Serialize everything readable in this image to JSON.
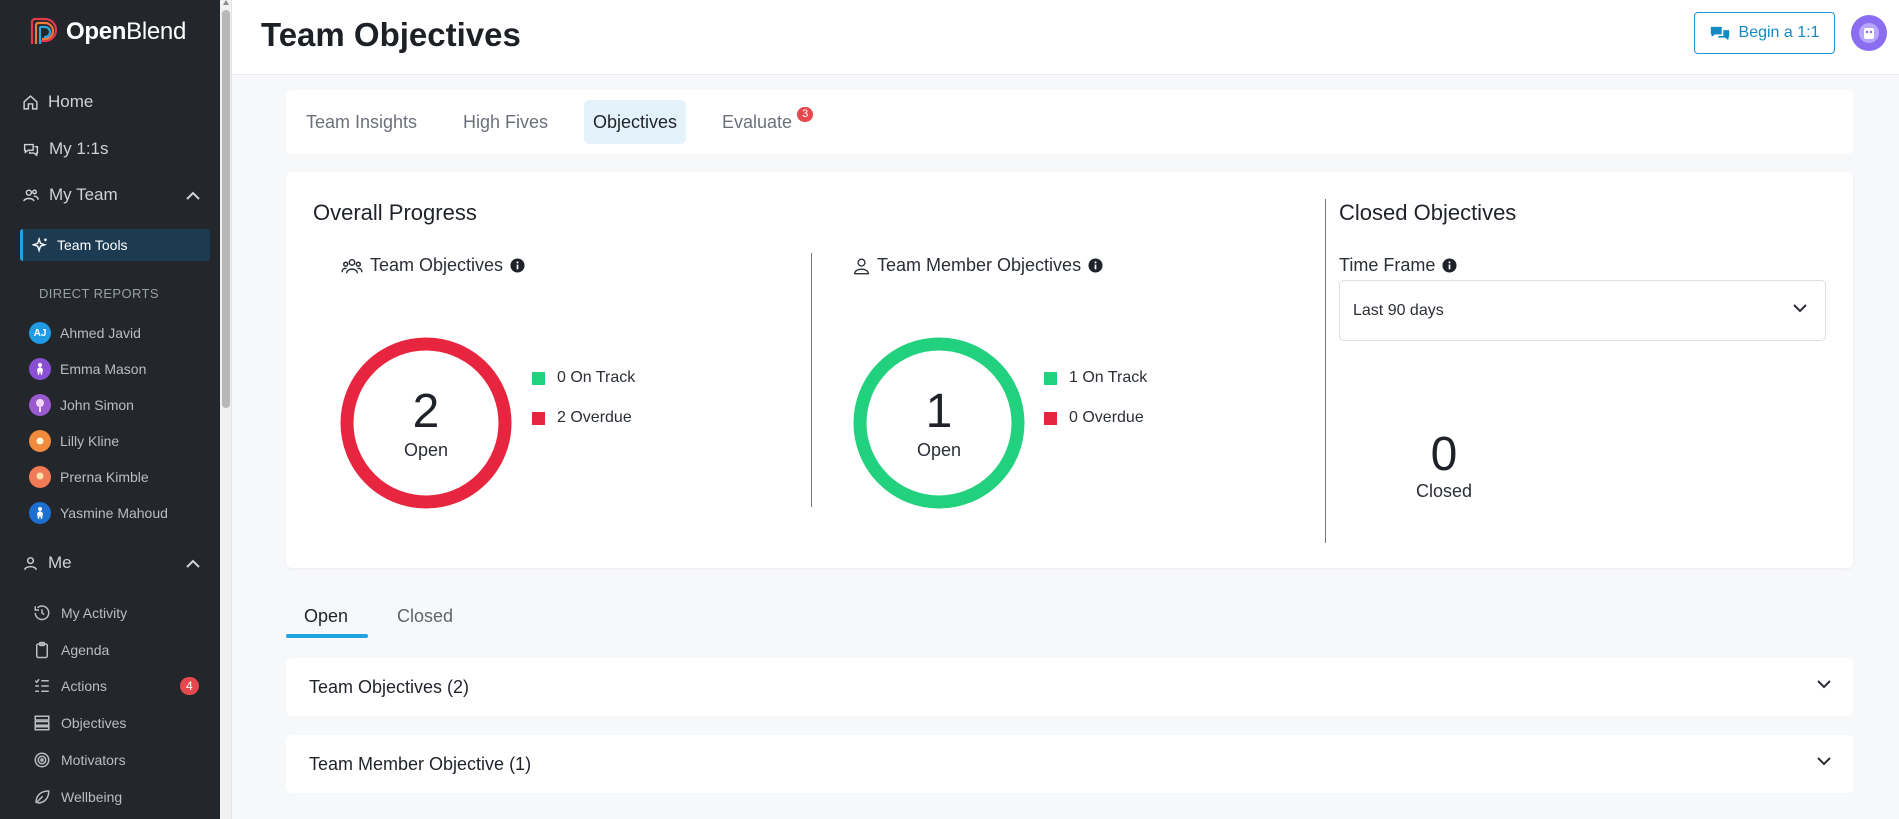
{
  "sidebar": {
    "logo": {
      "brand_bold": "Open",
      "brand_thin": "Blend"
    },
    "nav": {
      "home": "Home",
      "my_11s": "My 1:1s",
      "my_team": "My Team",
      "team_tools": "Team Tools",
      "me": "Me"
    },
    "direct_reports_label": "DIRECT REPORTS",
    "direct_reports": [
      {
        "name": "Ahmed Javid",
        "initials": "AJ",
        "color": "#1e9be3"
      },
      {
        "name": "Emma Mason",
        "initials": "",
        "color": "#8b4fd6"
      },
      {
        "name": "John Simon",
        "initials": "",
        "color": "#9a5bd1"
      },
      {
        "name": "Lilly Kline",
        "initials": "",
        "color": "#f08a3c"
      },
      {
        "name": "Prerna Kimble",
        "initials": "",
        "color": "#f07a55"
      },
      {
        "name": "Yasmine Mahoud",
        "initials": "",
        "color": "#1d6fd0"
      }
    ],
    "me_items": {
      "my_activity": "My Activity",
      "agenda": "Agenda",
      "actions": "Actions",
      "actions_count": "4",
      "objectives": "Objectives",
      "motivators": "Motivators",
      "wellbeing": "Wellbeing"
    }
  },
  "header": {
    "title": "Team Objectives",
    "begin_button": "Begin a 1:1"
  },
  "tabs": {
    "team_insights": "Team Insights",
    "high_fives": "High Fives",
    "objectives": "Objectives",
    "evaluate": "Evaluate",
    "evaluate_count": "3"
  },
  "progress": {
    "title": "Overall Progress",
    "team": {
      "heading": "Team Objectives",
      "count": "2",
      "count_label": "Open",
      "on_track": "0 On Track",
      "overdue": "2 Overdue",
      "ring_color": "#e8253f"
    },
    "member": {
      "heading": "Team Member Objectives",
      "count": "1",
      "count_label": "Open",
      "on_track": "1 On Track",
      "overdue": "0 Overdue",
      "ring_color": "#22d17e"
    },
    "closed": {
      "title": "Closed Objectives",
      "time_frame_label": "Time Frame",
      "time_frame_value": "Last 90 days",
      "count": "0",
      "count_label": "Closed"
    },
    "colors": {
      "on_track": "#22d17e",
      "overdue": "#e8253f"
    }
  },
  "list_tabs": {
    "open": "Open",
    "closed": "Closed"
  },
  "accordions": {
    "team": "Team Objectives (2)",
    "member": "Team Member Objective (1)"
  }
}
